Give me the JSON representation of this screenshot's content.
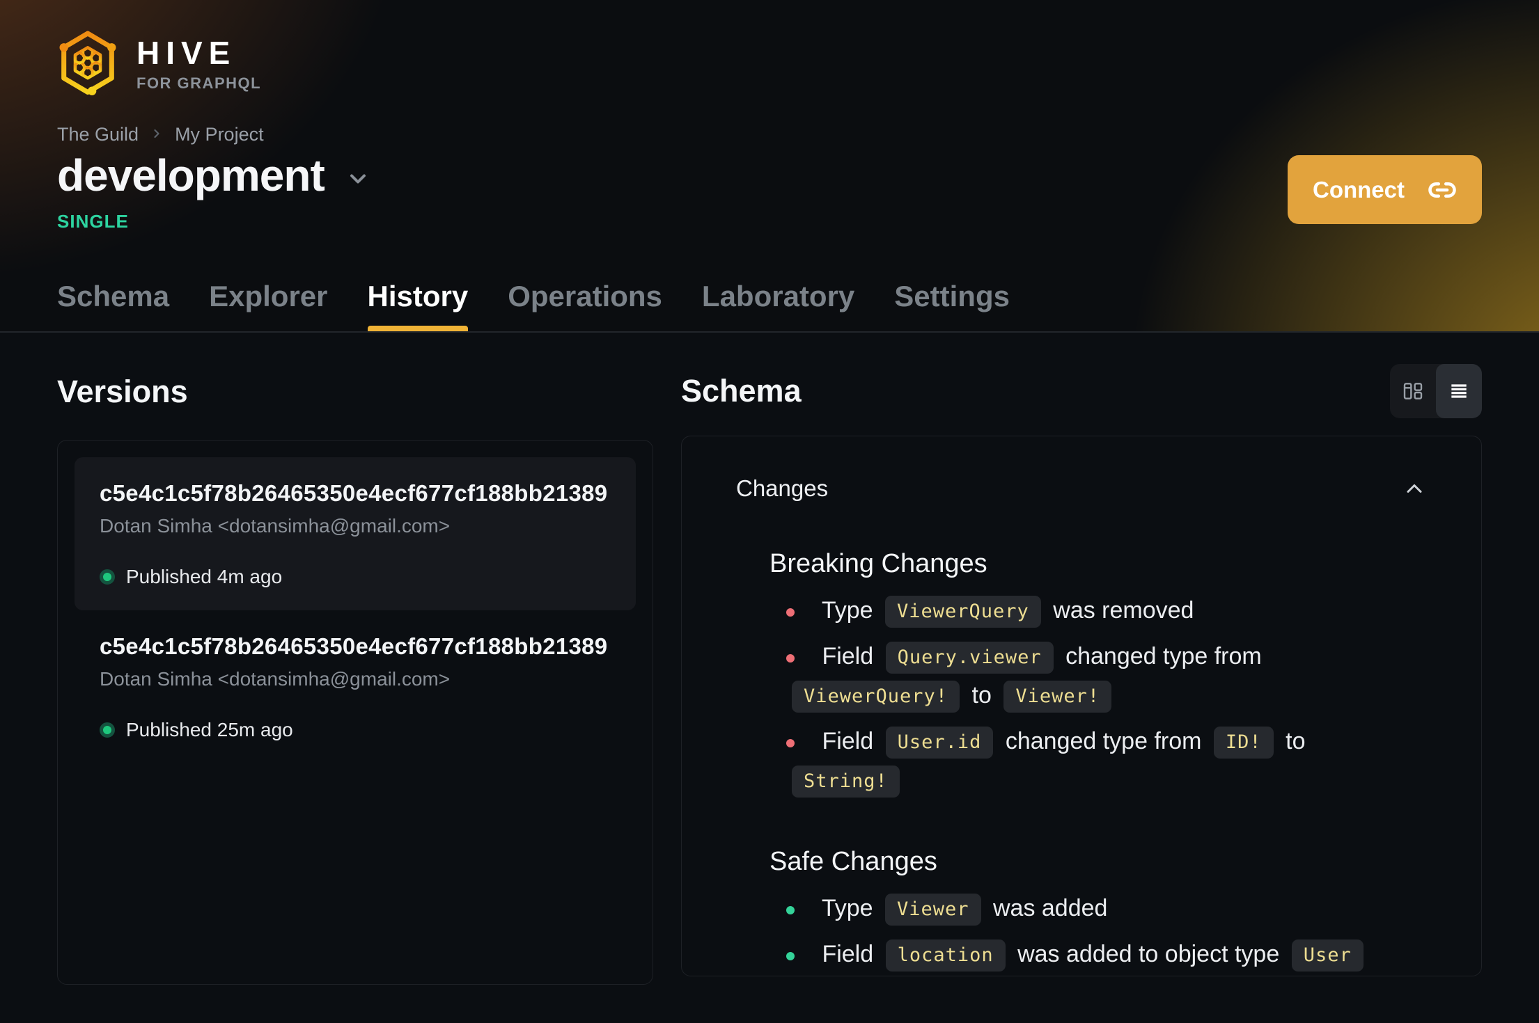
{
  "brand": {
    "name": "HIVE",
    "tagline": "FOR GRAPHQL"
  },
  "breadcrumb": {
    "items": [
      "The Guild",
      "My Project"
    ]
  },
  "target": {
    "name": "development",
    "badge": "SINGLE"
  },
  "connect": {
    "label": "Connect"
  },
  "tabs": [
    {
      "label": "Schema",
      "active": false
    },
    {
      "label": "Explorer",
      "active": false
    },
    {
      "label": "History",
      "active": true
    },
    {
      "label": "Operations",
      "active": false
    },
    {
      "label": "Laboratory",
      "active": false
    },
    {
      "label": "Settings",
      "active": false
    }
  ],
  "versions": {
    "title": "Versions",
    "cards": [
      {
        "hash": "c5e4c1c5f78b26465350e4ecf677cf188bb21389",
        "author": "Dotan Simha <dotansimha@gmail.com>",
        "status": "Published 4m ago",
        "active": true
      },
      {
        "hash": "c5e4c1c5f78b26465350e4ecf677cf188bb21389",
        "author": "Dotan Simha <dotansimha@gmail.com>",
        "status": "Published 25m ago",
        "active": false
      }
    ]
  },
  "schema_panel": {
    "title": "Schema",
    "changes_label": "Changes",
    "view_toggle": [
      "columns-view",
      "list-view"
    ],
    "sections": [
      {
        "heading": "Breaking Changes",
        "bullet_color": "#ee6f76",
        "items": [
          [
            {
              "text": "Type"
            },
            {
              "code": "ViewerQuery"
            },
            {
              "text": "was removed"
            }
          ],
          [
            {
              "text": "Field"
            },
            {
              "code": "Query.viewer"
            },
            {
              "text": "changed type from"
            },
            {
              "code": "ViewerQuery!"
            },
            {
              "text": "to"
            },
            {
              "code": "Viewer!"
            }
          ],
          [
            {
              "text": "Field"
            },
            {
              "code": "User.id"
            },
            {
              "text": "changed type from"
            },
            {
              "code": "ID!"
            },
            {
              "text": "to"
            },
            {
              "code": "String!"
            }
          ]
        ]
      },
      {
        "heading": "Safe Changes",
        "bullet_color": "#34d399",
        "items": [
          [
            {
              "text": "Type"
            },
            {
              "code": "Viewer"
            },
            {
              "text": "was added"
            }
          ],
          [
            {
              "text": "Field"
            },
            {
              "code": "location"
            },
            {
              "text": "was added to object type"
            },
            {
              "code": "User"
            }
          ]
        ]
      }
    ]
  },
  "colors": {
    "accent": "#e2a33d",
    "tab_underline": "#f0b336",
    "badge": "#2dd4a0",
    "code_text": "#eede92",
    "published_dot": "#1ec87d",
    "published_ring": "#14533f",
    "breaking_bullet": "#ee6f76",
    "safe_bullet": "#34d399"
  }
}
